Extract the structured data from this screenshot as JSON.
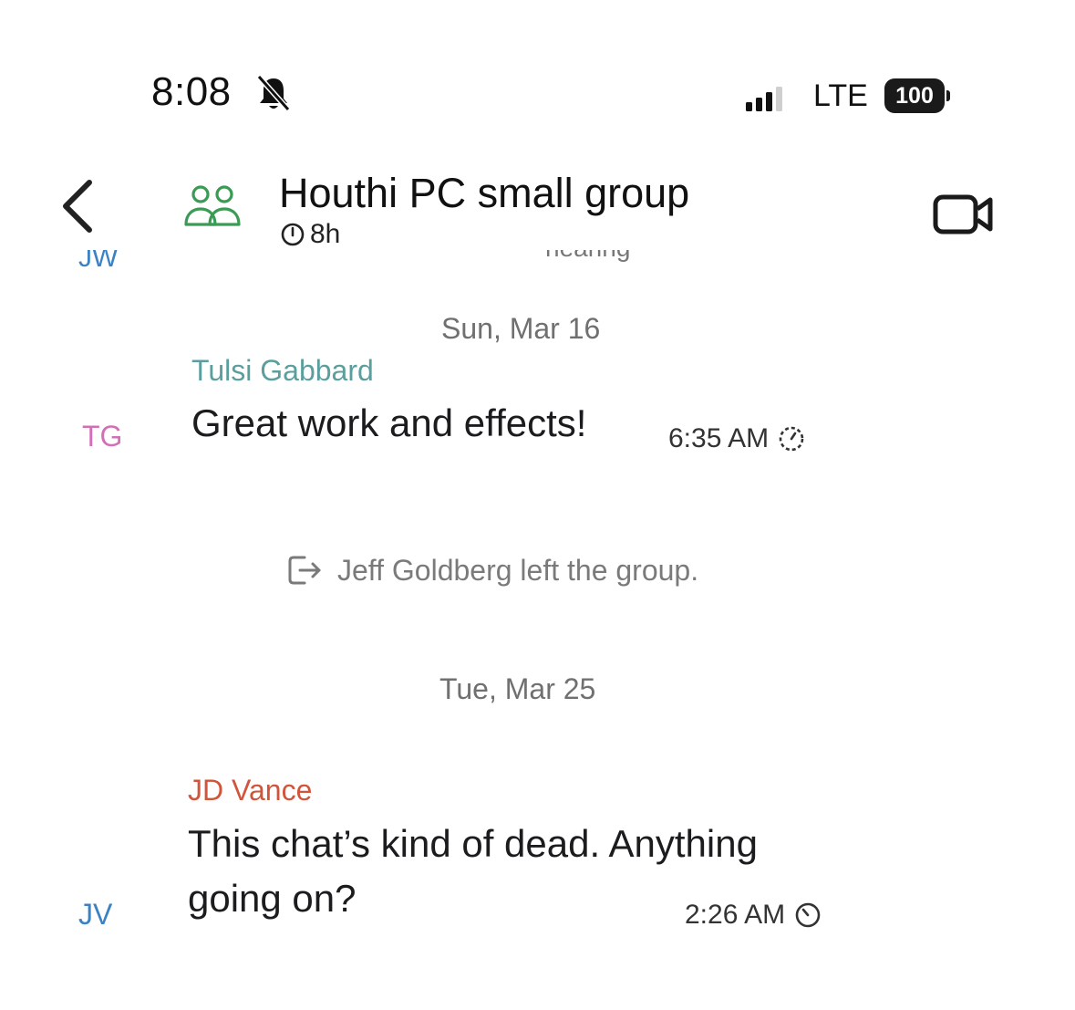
{
  "status_bar": {
    "time": "8:08",
    "network": "LTE",
    "battery": "100"
  },
  "header": {
    "title": "Houthi PC small group",
    "disappearing_timer": "8h"
  },
  "partial_row": {
    "avatar": "JW",
    "text": "hearing"
  },
  "messages": [
    {
      "date": "Sun, Mar 16",
      "sender": "Tulsi Gabbard",
      "sender_color": "#5a9e9e",
      "initials": "TG",
      "initials_color": "#d26fb6",
      "text": "Great work and effects!",
      "time": "6:35 AM"
    },
    {
      "date": "Tue, Mar 25",
      "sender": "JD Vance",
      "sender_color": "#d0553a",
      "initials": "JV",
      "initials_color": "#3b82c4",
      "text_line1": "This chat’s kind of dead. Anything",
      "text_line2": "going on?",
      "time": "2:26 AM"
    }
  ],
  "system_event": {
    "text": "Jeff Goldberg left the group."
  },
  "colors": {
    "group_icon": "#3a9b54",
    "text_primary": "#1c1c1e"
  }
}
